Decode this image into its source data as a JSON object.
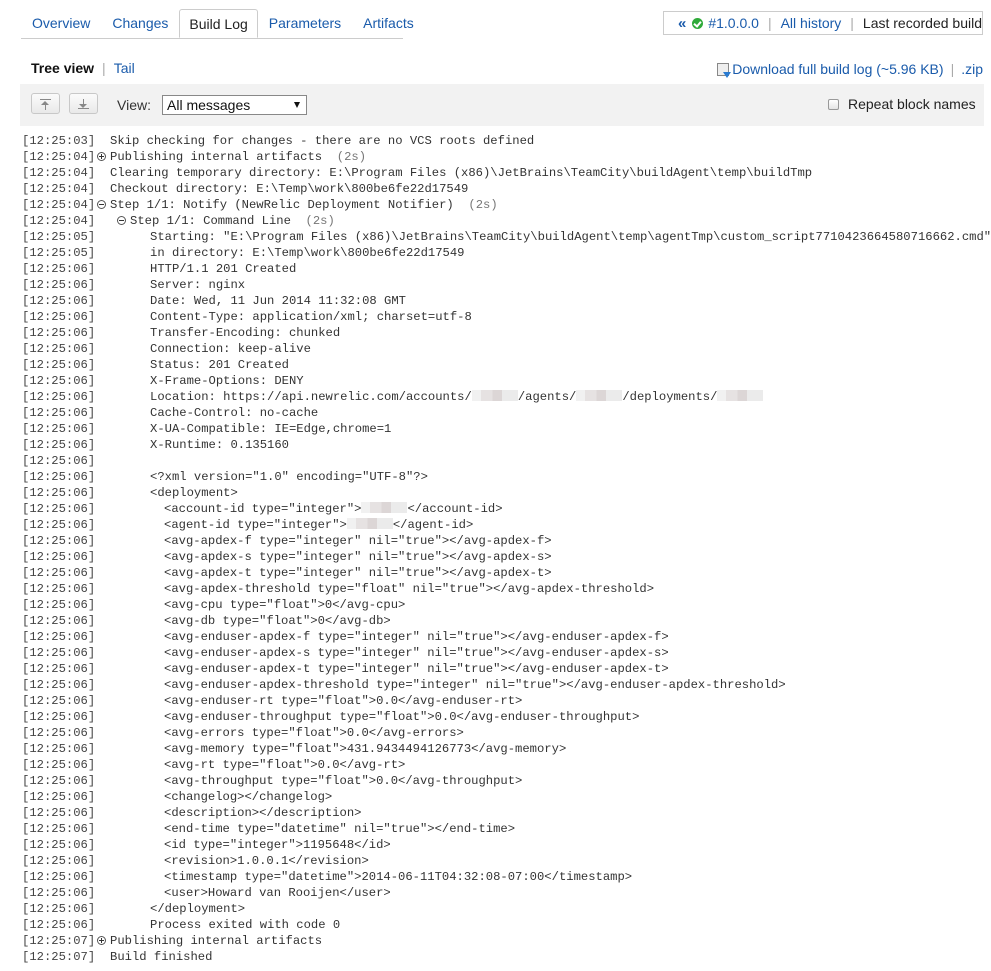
{
  "tabs": [
    {
      "label": "Overview",
      "active": false
    },
    {
      "label": "Changes",
      "active": false
    },
    {
      "label": "Build Log",
      "active": true
    },
    {
      "label": "Parameters",
      "active": false
    },
    {
      "label": "Artifacts",
      "active": false
    }
  ],
  "history": {
    "prev_icon": "«",
    "status_icon": "success-check-icon",
    "build_number": "#1.0.0.0",
    "all_history": "All history",
    "last_recorded": "Last recorded build"
  },
  "view_mode": {
    "tree_view": "Tree view",
    "separator": "|",
    "tail": "Tail"
  },
  "download": {
    "icon": "download-icon",
    "label": "Download full build log (~5.96 KB)",
    "separator": "|",
    "zip": ".zip"
  },
  "toolbar": {
    "scroll_top_icon": "scroll-to-top-icon",
    "scroll_bottom_icon": "scroll-to-bottom-icon",
    "view_label": "View:",
    "view_selected": "All messages",
    "repeat_block_names": "Repeat block names",
    "repeat_checked": false
  },
  "colors": {
    "link": "#1a5bab",
    "success": "#2faa39",
    "toolbar_bg": "#f2f2f2"
  },
  "log": [
    {
      "ts": "[12:25:03]",
      "indent": 0,
      "toggle": null,
      "text": "Skip checking for changes - there are no VCS roots defined"
    },
    {
      "ts": "[12:25:04]",
      "indent": 0,
      "toggle": "plus",
      "text": "Publishing internal artifacts",
      "dur": "(2s)"
    },
    {
      "ts": "[12:25:04]",
      "indent": 0,
      "toggle": null,
      "text": "Clearing temporary directory: E:\\Program Files (x86)\\JetBrains\\TeamCity\\buildAgent\\temp\\buildTmp"
    },
    {
      "ts": "[12:25:04]",
      "indent": 0,
      "toggle": null,
      "text": "Checkout directory: E:\\Temp\\work\\800be6fe22d17549"
    },
    {
      "ts": "[12:25:04]",
      "indent": 0,
      "toggle": "minus",
      "text": "Step 1/1: Notify (NewRelic Deployment Notifier)",
      "dur": "(2s)"
    },
    {
      "ts": "[12:25:04]",
      "indent": 1,
      "toggle": "minus",
      "text": "Step 1/1: Command Line",
      "dur": "(2s)"
    },
    {
      "ts": "[12:25:05]",
      "indent": 2,
      "toggle": null,
      "text": "Starting: \"E:\\Program Files (x86)\\JetBrains\\TeamCity\\buildAgent\\temp\\agentTmp\\custom_script7710423664580716662.cmd\""
    },
    {
      "ts": "[12:25:05]",
      "indent": 2,
      "toggle": null,
      "text": "in directory: E:\\Temp\\work\\800be6fe22d17549"
    },
    {
      "ts": "[12:25:06]",
      "indent": 2,
      "toggle": null,
      "text": "HTTP/1.1 201 Created"
    },
    {
      "ts": "[12:25:06]",
      "indent": 2,
      "toggle": null,
      "text": "Server: nginx"
    },
    {
      "ts": "[12:25:06]",
      "indent": 2,
      "toggle": null,
      "text": "Date: Wed, 11 Jun 2014 11:32:08 GMT"
    },
    {
      "ts": "[12:25:06]",
      "indent": 2,
      "toggle": null,
      "text": "Content-Type: application/xml; charset=utf-8"
    },
    {
      "ts": "[12:25:06]",
      "indent": 2,
      "toggle": null,
      "text": "Transfer-Encoding: chunked"
    },
    {
      "ts": "[12:25:06]",
      "indent": 2,
      "toggle": null,
      "text": "Connection: keep-alive"
    },
    {
      "ts": "[12:25:06]",
      "indent": 2,
      "toggle": null,
      "text": "Status: 201 Created"
    },
    {
      "ts": "[12:25:06]",
      "indent": 2,
      "toggle": null,
      "text": "X-Frame-Options: DENY"
    },
    {
      "ts": "[12:25:06]",
      "indent": 2,
      "toggle": null,
      "parts": [
        "Location: https://api.newrelic.com/accounts/",
        "#",
        "/agents/",
        "#",
        "/deployments/",
        "#"
      ]
    },
    {
      "ts": "[12:25:06]",
      "indent": 2,
      "toggle": null,
      "text": "Cache-Control: no-cache"
    },
    {
      "ts": "[12:25:06]",
      "indent": 2,
      "toggle": null,
      "text": "X-UA-Compatible: IE=Edge,chrome=1"
    },
    {
      "ts": "[12:25:06]",
      "indent": 2,
      "toggle": null,
      "text": "X-Runtime: 0.135160"
    },
    {
      "ts": "[12:25:06]",
      "indent": 2,
      "toggle": null,
      "text": ""
    },
    {
      "ts": "[12:25:06]",
      "indent": 2,
      "toggle": null,
      "text": "<?xml version=\"1.0\" encoding=\"UTF-8\"?>"
    },
    {
      "ts": "[12:25:06]",
      "indent": 2,
      "toggle": null,
      "text": "<deployment>"
    },
    {
      "ts": "[12:25:06]",
      "indent": 3,
      "toggle": null,
      "parts": [
        "<account-id type=\"integer\">",
        "#",
        "</account-id>"
      ]
    },
    {
      "ts": "[12:25:06]",
      "indent": 3,
      "toggle": null,
      "parts": [
        "<agent-id type=\"integer\">",
        "#",
        "</agent-id>"
      ]
    },
    {
      "ts": "[12:25:06]",
      "indent": 3,
      "toggle": null,
      "text": "<avg-apdex-f type=\"integer\" nil=\"true\"></avg-apdex-f>"
    },
    {
      "ts": "[12:25:06]",
      "indent": 3,
      "toggle": null,
      "text": "<avg-apdex-s type=\"integer\" nil=\"true\"></avg-apdex-s>"
    },
    {
      "ts": "[12:25:06]",
      "indent": 3,
      "toggle": null,
      "text": "<avg-apdex-t type=\"integer\" nil=\"true\"></avg-apdex-t>"
    },
    {
      "ts": "[12:25:06]",
      "indent": 3,
      "toggle": null,
      "text": "<avg-apdex-threshold type=\"float\" nil=\"true\"></avg-apdex-threshold>"
    },
    {
      "ts": "[12:25:06]",
      "indent": 3,
      "toggle": null,
      "text": "<avg-cpu type=\"float\">0</avg-cpu>"
    },
    {
      "ts": "[12:25:06]",
      "indent": 3,
      "toggle": null,
      "text": "<avg-db type=\"float\">0</avg-db>"
    },
    {
      "ts": "[12:25:06]",
      "indent": 3,
      "toggle": null,
      "text": "<avg-enduser-apdex-f type=\"integer\" nil=\"true\"></avg-enduser-apdex-f>"
    },
    {
      "ts": "[12:25:06]",
      "indent": 3,
      "toggle": null,
      "text": "<avg-enduser-apdex-s type=\"integer\" nil=\"true\"></avg-enduser-apdex-s>"
    },
    {
      "ts": "[12:25:06]",
      "indent": 3,
      "toggle": null,
      "text": "<avg-enduser-apdex-t type=\"integer\" nil=\"true\"></avg-enduser-apdex-t>"
    },
    {
      "ts": "[12:25:06]",
      "indent": 3,
      "toggle": null,
      "text": "<avg-enduser-apdex-threshold type=\"integer\" nil=\"true\"></avg-enduser-apdex-threshold>"
    },
    {
      "ts": "[12:25:06]",
      "indent": 3,
      "toggle": null,
      "text": "<avg-enduser-rt type=\"float\">0.0</avg-enduser-rt>"
    },
    {
      "ts": "[12:25:06]",
      "indent": 3,
      "toggle": null,
      "text": "<avg-enduser-throughput type=\"float\">0.0</avg-enduser-throughput>"
    },
    {
      "ts": "[12:25:06]",
      "indent": 3,
      "toggle": null,
      "text": "<avg-errors type=\"float\">0.0</avg-errors>"
    },
    {
      "ts": "[12:25:06]",
      "indent": 3,
      "toggle": null,
      "text": "<avg-memory type=\"float\">431.9434494126773</avg-memory>"
    },
    {
      "ts": "[12:25:06]",
      "indent": 3,
      "toggle": null,
      "text": "<avg-rt type=\"float\">0.0</avg-rt>"
    },
    {
      "ts": "[12:25:06]",
      "indent": 3,
      "toggle": null,
      "text": "<avg-throughput type=\"float\">0.0</avg-throughput>"
    },
    {
      "ts": "[12:25:06]",
      "indent": 3,
      "toggle": null,
      "text": "<changelog></changelog>"
    },
    {
      "ts": "[12:25:06]",
      "indent": 3,
      "toggle": null,
      "text": "<description></description>"
    },
    {
      "ts": "[12:25:06]",
      "indent": 3,
      "toggle": null,
      "text": "<end-time type=\"datetime\" nil=\"true\"></end-time>"
    },
    {
      "ts": "[12:25:06]",
      "indent": 3,
      "toggle": null,
      "text": "<id type=\"integer\">1195648</id>"
    },
    {
      "ts": "[12:25:06]",
      "indent": 3,
      "toggle": null,
      "text": "<revision>1.0.0.1</revision>"
    },
    {
      "ts": "[12:25:06]",
      "indent": 3,
      "toggle": null,
      "text": "<timestamp type=\"datetime\">2014-06-11T04:32:08-07:00</timestamp>"
    },
    {
      "ts": "[12:25:06]",
      "indent": 3,
      "toggle": null,
      "text": "<user>Howard van Rooijen</user>"
    },
    {
      "ts": "[12:25:06]",
      "indent": 2,
      "toggle": null,
      "text": "</deployment>"
    },
    {
      "ts": "[12:25:06]",
      "indent": 2,
      "toggle": null,
      "text": "Process exited with code 0"
    },
    {
      "ts": "[12:25:07]",
      "indent": 0,
      "toggle": "plus",
      "text": "Publishing internal artifacts"
    },
    {
      "ts": "[12:25:07]",
      "indent": 0,
      "toggle": null,
      "text": "Build finished"
    }
  ]
}
